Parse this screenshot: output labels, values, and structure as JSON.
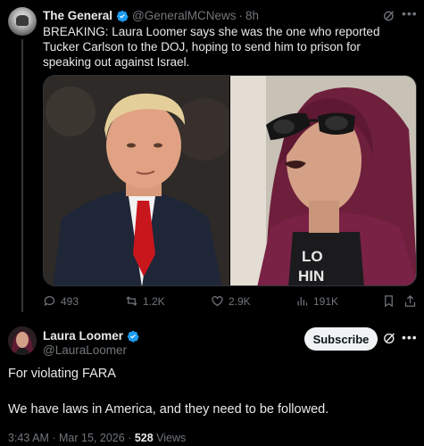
{
  "colors": {
    "background": "#000000",
    "text": "#e7e9ea",
    "muted": "#71767b",
    "verified": "#1d9bf0",
    "subscribe_bg": "#eff3f4"
  },
  "quoted_post": {
    "author_name": "The General",
    "handle": "@GeneralMCNews",
    "separator": "·",
    "time": "8h",
    "text": "BREAKING: Laura Loomer says she was the one who reported Tucker Carlson to the DOJ, hoping to send him to prison for speaking out against Israel.",
    "media": {
      "left_photo_icon": "portrait-man-red-tie",
      "right_photo_icon": "portrait-woman-sunglasses",
      "right_shirt_text": "LO\nHIN"
    },
    "actions": {
      "replies": "493",
      "reposts": "1.2K",
      "likes": "2.9K",
      "views": "191K"
    }
  },
  "main_post": {
    "author_name": "Laura Loomer",
    "handle": "@LauraLoomer",
    "subscribe_label": "Subscribe",
    "paragraphs": [
      "For violating FARA",
      "We have laws in America, and they need to be followed."
    ],
    "time": "3:43 AM",
    "dot": "·",
    "date": "Mar 15, 2026",
    "views_count": "528",
    "views_label": "Views"
  }
}
